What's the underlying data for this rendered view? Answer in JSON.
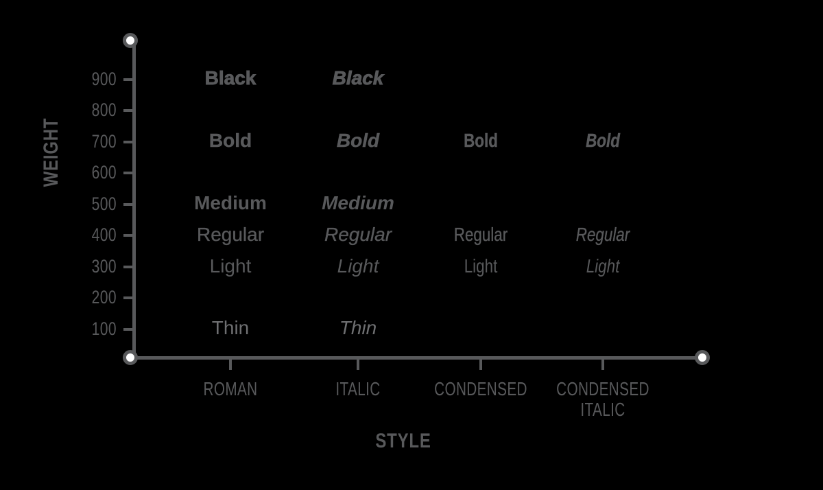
{
  "chart_data": {
    "type": "scatter",
    "title": "",
    "xlabel": "STYLE",
    "ylabel": "WEIGHT",
    "grid": false,
    "legend": "none",
    "ylim": [
      0,
      1000
    ],
    "y_ticks": [
      900,
      800,
      700,
      600,
      500,
      400,
      300,
      200,
      100
    ],
    "categories": [
      "ROMAN",
      "ITALIC",
      "CONDENSED",
      "CONDENSED ITALIC"
    ],
    "series": [
      {
        "name": "ROMAN",
        "style": "roman",
        "points": [
          {
            "label": "Black",
            "weight": 900
          },
          {
            "label": "Bold",
            "weight": 700
          },
          {
            "label": "Medium",
            "weight": 500
          },
          {
            "label": "Regular",
            "weight": 400
          },
          {
            "label": "Light",
            "weight": 300
          },
          {
            "label": "Thin",
            "weight": 100
          }
        ]
      },
      {
        "name": "ITALIC",
        "style": "italic",
        "points": [
          {
            "label": "Black",
            "weight": 900
          },
          {
            "label": "Bold",
            "weight": 700
          },
          {
            "label": "Medium",
            "weight": 500
          },
          {
            "label": "Regular",
            "weight": 400
          },
          {
            "label": "Light",
            "weight": 300
          },
          {
            "label": "Thin",
            "weight": 100
          }
        ]
      },
      {
        "name": "CONDENSED",
        "style": "condensed",
        "points": [
          {
            "label": "Bold",
            "weight": 700
          },
          {
            "label": "Regular",
            "weight": 400
          },
          {
            "label": "Light",
            "weight": 300
          }
        ]
      },
      {
        "name": "CONDENSED ITALIC",
        "style": "condensed-italic",
        "points": [
          {
            "label": "Bold",
            "weight": 700
          },
          {
            "label": "Regular",
            "weight": 400
          },
          {
            "label": "Light",
            "weight": 300
          }
        ]
      }
    ]
  },
  "axes": {
    "y_title": "WEIGHT",
    "x_title": "STYLE",
    "y_tick_labels": [
      "900",
      "800",
      "700",
      "600",
      "500",
      "400",
      "300",
      "200",
      "100"
    ],
    "x_tick_labels": [
      "ROMAN",
      "ITALIC",
      "CONDENSED",
      "CONDENSED ITALIC"
    ]
  },
  "points": {
    "roman_black": "Black",
    "roman_bold": "Bold",
    "roman_medium": "Medium",
    "roman_regular": "Regular",
    "roman_light": "Light",
    "roman_thin": "Thin",
    "italic_black": "Black",
    "italic_bold": "Bold",
    "italic_medium": "Medium",
    "italic_regular": "Regular",
    "italic_light": "Light",
    "italic_thin": "Thin",
    "cond_bold": "Bold",
    "cond_regular": "Regular",
    "cond_light": "Light",
    "condital_bold": "Bold",
    "condital_regular": "Regular",
    "condital_light": "Light"
  },
  "colors": {
    "background": "#000000",
    "axis": "#58595B",
    "text": "#58595B",
    "cap_fill": "#ffffff"
  }
}
